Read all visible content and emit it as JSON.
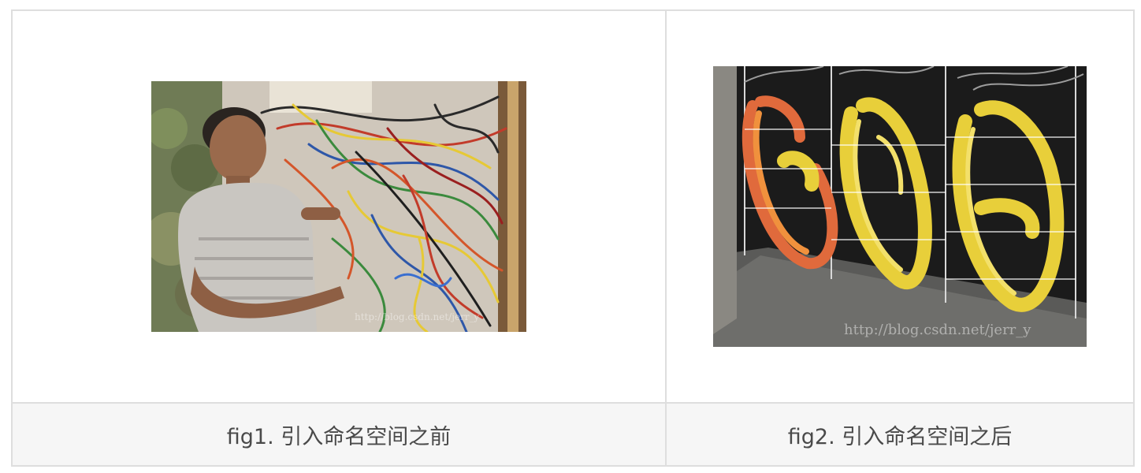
{
  "figures": [
    {
      "caption": "fig1. 引入命名空间之前",
      "image": "photo-tangled-cables",
      "watermark": "http://blog.csdn.net/jerr_y"
    },
    {
      "caption": "fig2. 引入命名空间之后",
      "image": "photo-organized-cables",
      "watermark": "http://blog.csdn.net/jerr_y"
    }
  ],
  "colors": {
    "border": "#dedede",
    "caption_bg": "#f6f6f6",
    "caption_text": "#4a4a4a"
  }
}
